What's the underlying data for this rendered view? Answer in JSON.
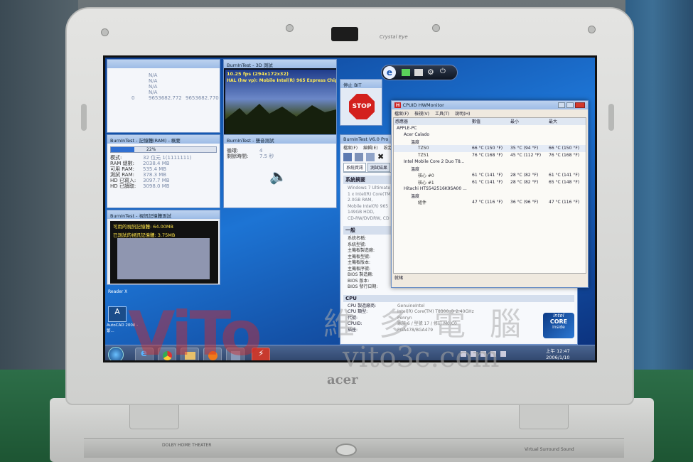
{
  "bezel": {
    "cam_label": "Crystal Eye",
    "brand": "acer",
    "kbd_brand": "DOLBY HOME THEATER",
    "kbd_right": "Virtual Surround Sound"
  },
  "tl_window": {
    "title": "",
    "col1": "",
    "col2": "",
    "col3": "",
    "rows": [
      {
        "k": "",
        "v1": "",
        "v2": "N/A",
        "v3": ""
      },
      {
        "k": "",
        "v1": "",
        "v2": "N/A",
        "v3": ""
      },
      {
        "k": "",
        "v1": "",
        "v2": "N/A",
        "v3": ""
      },
      {
        "k": "",
        "v1": "",
        "v2": "N/A",
        "v3": ""
      },
      {
        "k": "",
        "v1": "0",
        "v2": "9653682.772",
        "v3": "9653682.770"
      }
    ]
  },
  "video_window": {
    "title": "BurnInTest - 3D 測試",
    "fps": "10.25 fps (294x172x32)",
    "hal": "HAL (hw vp): Mobile Intel(R) 965 Express Chipset Far"
  },
  "ram_window": {
    "title": "BurnInTest - 記憶體(RAM) - 概要",
    "progress_pct": 22,
    "progress_label": "22%",
    "rows": [
      {
        "k": "模式:",
        "v": "32 位元 1(1111111)"
      },
      {
        "k": "RAM 總數:",
        "v": "2038.4 MB"
      },
      {
        "k": "可用 RAM:",
        "v": "535.4 MB"
      },
      {
        "k": "測試 RAM:",
        "v": "378.3 MB"
      },
      {
        "k": "HD 已寫入:",
        "v": "3097.7 MB"
      },
      {
        "k": "HD 已讀取:",
        "v": "3098.0 MB"
      }
    ]
  },
  "sound_window": {
    "title": "BurnInTest - 聲音測試",
    "rows": [
      {
        "k": "循環:",
        "v": "4"
      },
      {
        "k": "剩餘時間:",
        "v": "7.5 秒"
      }
    ]
  },
  "mem_window": {
    "title": "BurnInTest - 視訊記憶體測試",
    "line1": "可用的視訊記憶體: 64.00MB",
    "line2": "已測試的視訊記憶體: 3.75MB"
  },
  "stop_panel": {
    "title": "停止 BIT",
    "stop": "STOP"
  },
  "bit_main": {
    "title": "BurnInTest V6.0 Pro",
    "menu": [
      "檔案(F)",
      "編輯(E)",
      "設定(C)"
    ],
    "tabs": [
      "系統資訊",
      "測試結果"
    ],
    "section1": "系統摘要",
    "summary": [
      "Windows 7 Ultimate",
      "1 x Intel(R) Core(TM)",
      "2.0GB RAM,",
      "Mobile Intel(R) 965",
      "149GB HDD,",
      "CD-RW/DVDRW, CD"
    ],
    "section2": "一般",
    "general": [
      "系統名稱:",
      "系統型號:",
      "主機板製造廠:",
      "主機板型號:",
      "主機板版本:",
      "主機板序號:",
      "BIOS 製造廠:",
      "BIOS 版本:",
      "BIOS 發行日期:"
    ],
    "section3": "CPU",
    "cpu_keys": [
      "CPU 製造廠商:",
      "CPU 類型:",
      "代號:",
      "CPUID:",
      "插座:"
    ],
    "cpu_vals": [
      "GenuineIntel",
      "Intel(R) Core(TM) T8300 @ 2.40GHz",
      "Penryn",
      "家族 6 / 型號 17 / 修訂 M0/C0",
      "PGA478/BGA479"
    ]
  },
  "hwmon": {
    "title": "CPUID HWMonitor",
    "menu": [
      "檔案(F)",
      "檢視(V)",
      "工具(T)",
      "說明(H)"
    ],
    "cols": [
      "感應器",
      "數值",
      "最小",
      "最大"
    ],
    "rows": [
      {
        "d": 0,
        "name": "APPLE-PC",
        "val": "",
        "min": "",
        "max": ""
      },
      {
        "d": 1,
        "name": "Acer Calado",
        "val": "",
        "min": "",
        "max": ""
      },
      {
        "d": 2,
        "name": "溫度",
        "val": "",
        "min": "",
        "max": ""
      },
      {
        "d": 3,
        "name": "TZ50",
        "val": "66 °C (150 °F)",
        "min": "35 °C (94 °F)",
        "max": "66 °C (150 °F)"
      },
      {
        "d": 3,
        "name": "TZ51",
        "val": "76 °C (168 °F)",
        "min": "45 °C (112 °F)",
        "max": "76 °C (168 °F)"
      },
      {
        "d": 1,
        "name": "Intel Mobile Core 2 Duo T8...",
        "val": "",
        "min": "",
        "max": ""
      },
      {
        "d": 2,
        "name": "溫度",
        "val": "",
        "min": "",
        "max": ""
      },
      {
        "d": 3,
        "name": "核心 #0",
        "val": "61 °C (141 °F)",
        "min": "28 °C (82 °F)",
        "max": "61 °C (141 °F)"
      },
      {
        "d": 3,
        "name": "核心 #1",
        "val": "61 °C (141 °F)",
        "min": "28 °C (82 °F)",
        "max": "65 °C (148 °F)"
      },
      {
        "d": 1,
        "name": "Hitachi HTS542516K9SA00 ...",
        "val": "",
        "min": "",
        "max": ""
      },
      {
        "d": 2,
        "name": "溫度",
        "val": "",
        "min": "",
        "max": ""
      },
      {
        "d": 3,
        "name": "組件",
        "val": "47 °C (116 °F)",
        "min": "36 °C (96 °F)",
        "max": "47 °C (116 °F)"
      }
    ],
    "status": "就緒"
  },
  "desktop": {
    "autocad": "AutoCAD 2008 - 繁...",
    "reader": "Reader X"
  },
  "clock": {
    "time": "上午 12:47",
    "date": "2006/1/10"
  },
  "intel_badge": {
    "brand": "intel",
    "line1": "CORE",
    "line2": "2",
    "line3": "inside"
  },
  "watermark": {
    "latin": "ViTo",
    "cjk": "維 多 電 腦",
    "url": "vito3c.com"
  },
  "colors": {
    "accent": "#1d74d4",
    "stop": "#d3201d",
    "hw_header": "#dfe7f2"
  }
}
